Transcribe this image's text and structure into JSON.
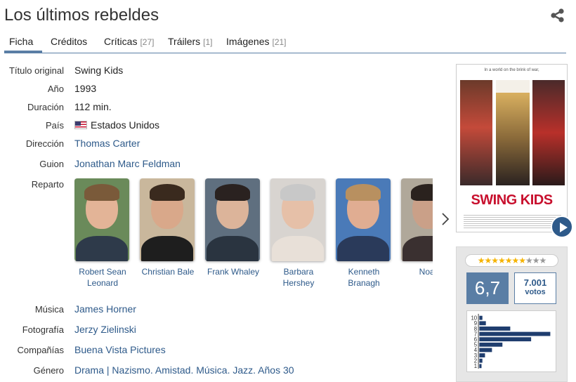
{
  "title": "Los últimos rebeldes",
  "tabs": [
    {
      "label": "Ficha",
      "count": ""
    },
    {
      "label": "Créditos",
      "count": ""
    },
    {
      "label": "Críticas",
      "count": "[27]"
    },
    {
      "label": "Tráilers",
      "count": "[1]"
    },
    {
      "label": "Imágenes",
      "count": "[21]"
    }
  ],
  "details": {
    "original_title_label": "Título original",
    "original_title": "Swing Kids",
    "year_label": "Año",
    "year": "1993",
    "duration_label": "Duración",
    "duration": "112 min.",
    "country_label": "País",
    "country": "Estados Unidos",
    "director_label": "Dirección",
    "director": "Thomas Carter",
    "writer_label": "Guion",
    "writer": "Jonathan Marc Feldman",
    "cast_label": "Reparto",
    "music_label": "Música",
    "music": "James Horner",
    "photography_label": "Fotografía",
    "photography": "Jerzy Zielinski",
    "companies_label": "Compañías",
    "companies": "Buena Vista Pictures",
    "genre_label": "Género",
    "genre": "Drama | Nazismo. Amistad. Música. Jazz. Años 30"
  },
  "cast": [
    {
      "name": "Robert Sean Leonard",
      "skin": "#e3b497",
      "hair": "#7a5a3a",
      "shirt": "#2e3a4a",
      "bg": "#6a8a5a"
    },
    {
      "name": "Christian Bale",
      "skin": "#d9a88a",
      "hair": "#3a2a1e",
      "shirt": "#1e1e1e",
      "bg": "#c9b79c"
    },
    {
      "name": "Frank Whaley",
      "skin": "#dcb49a",
      "hair": "#2a2220",
      "shirt": "#2a3440",
      "bg": "#5f6f7f"
    },
    {
      "name": "Barbara Hershey",
      "skin": "#e6c0a8",
      "hair": "#c8c8c8",
      "shirt": "#e8e0d8",
      "bg": "#d8d4d0"
    },
    {
      "name": "Kenneth Branagh",
      "skin": "#e0ad92",
      "hair": "#b89060",
      "shirt": "#2a3a5a",
      "bg": "#4a7ab8"
    },
    {
      "name": "Noah",
      "skin": "#caa088",
      "hair": "#2a221e",
      "shirt": "#3a3030",
      "bg": "#b0a89a"
    }
  ],
  "poster": {
    "tagline": "In a world on the brink of war,",
    "tagline2": "they either march to one tune or dance to another.",
    "title": "SWING KIDS"
  },
  "rating": {
    "stars_on": "★★★★★★★",
    "stars_off": "★★★",
    "score": "6,7",
    "votes": "7.001",
    "votes_label": "votos",
    "histogram": {
      "labels": [
        "10",
        "9",
        "8",
        "7",
        "6",
        "5",
        "4",
        "3",
        "2",
        "1"
      ],
      "values": [
        4,
        8,
        36,
        82,
        60,
        27,
        15,
        7,
        4,
        3
      ]
    }
  },
  "colors": {
    "accent": "#5a7ea5",
    "link": "#2e5a8a",
    "star": "#f5b301"
  }
}
